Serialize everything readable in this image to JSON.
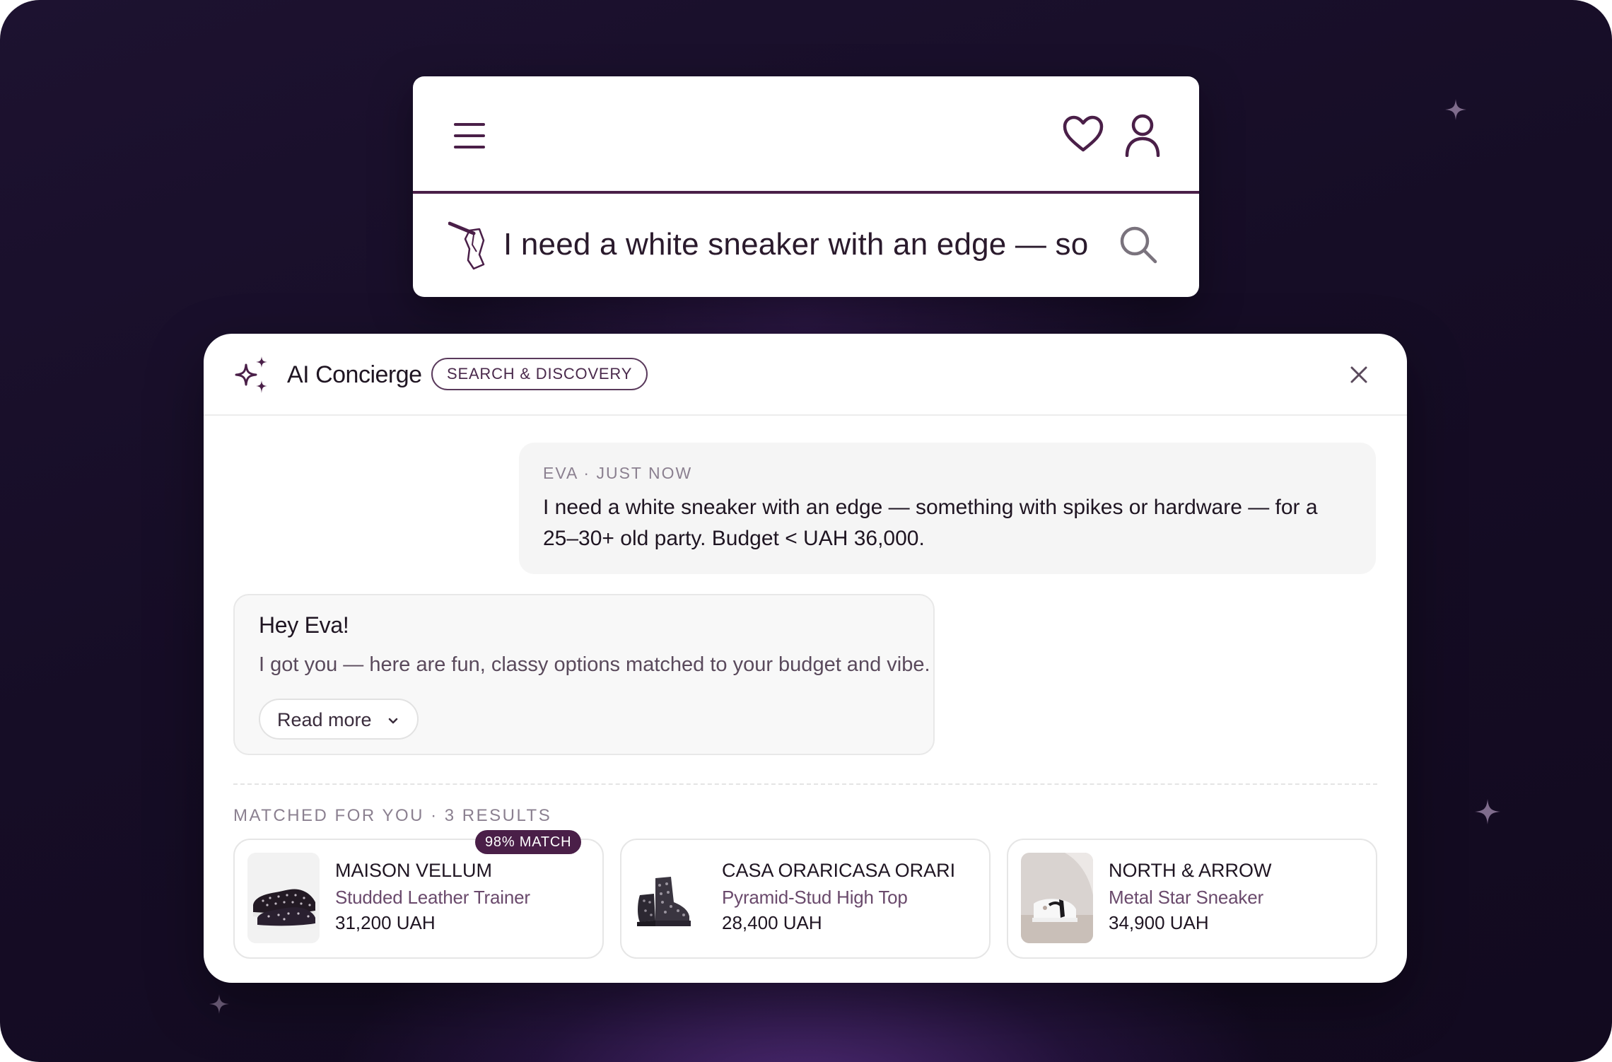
{
  "colors": {
    "brand": "#4a1f48",
    "background_dark": "#160d26",
    "text_primary": "#1f1522",
    "text_muted": "#8b8090"
  },
  "search": {
    "query": "I need a white sneaker with an edge — so…",
    "icons": [
      "menu-icon",
      "heart-icon",
      "user-icon",
      "brand-logo-icon",
      "search-icon"
    ]
  },
  "panel": {
    "title": "AI Concierge",
    "tag": "SEARCH & DISCOVERY",
    "user_message": {
      "meta": "EVA · JUST NOW",
      "text": "I need a white sneaker with an edge — something with spikes or hardware — for a 25–30+ old party. Budget < UAH 36,000."
    },
    "bot_message": {
      "greeting": "Hey Eva!",
      "text": "I got you — here are fun, classy options matched to your budget and vibe.",
      "read_more": "Read more"
    },
    "results_label": "MATCHED FOR YOU · 3 RESULTS",
    "products": [
      {
        "brand": "MAISON VELLUM",
        "name": "Studded Leather Trainer",
        "price": "31,200 UAH",
        "badge": "98% MATCH"
      },
      {
        "brand": "CASA ORARICASA ORARI",
        "name": "Pyramid-Stud High Top",
        "price": "28,400 UAH"
      },
      {
        "brand": "NORTH & ARROW",
        "name": "Metal Star Sneaker",
        "price": "34,900 UAH"
      }
    ]
  }
}
